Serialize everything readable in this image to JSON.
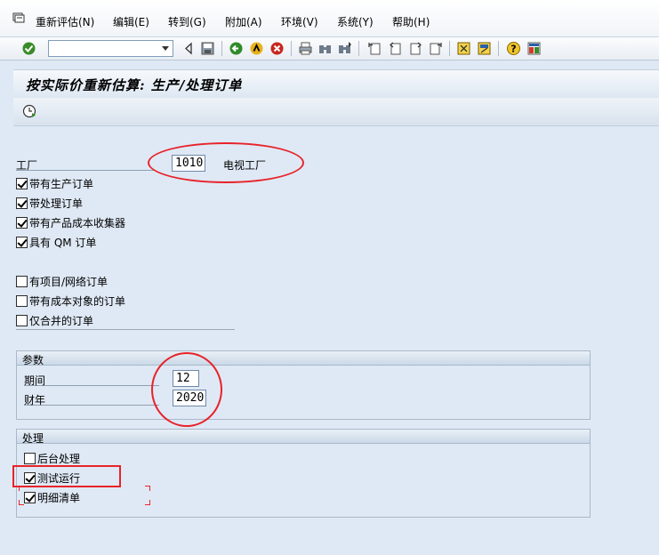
{
  "menu": {
    "items": [
      "重新评估(N)",
      "编辑(E)",
      "转到(G)",
      "附加(A)",
      "环境(V)",
      "系统(Y)",
      "帮助(H)"
    ]
  },
  "toolbar": {
    "command_value": "",
    "icons": [
      "enter-check-icon",
      "back-triangle-icon",
      "save-icon",
      "back-green-icon",
      "exit-yellow-icon",
      "cancel-red-icon",
      "print-icon",
      "find-icon",
      "find-next-icon",
      "first-page-icon",
      "prev-page-icon",
      "next-page-icon",
      "last-page-icon",
      "new-session-icon",
      "shortcut-icon",
      "help-icon",
      "customize-layout-icon"
    ]
  },
  "title": "按实际价重新估算: 生产/处理订单",
  "form": {
    "plant_label": "工厂",
    "plant_value": "1010",
    "plant_desc": "电视工厂",
    "checkboxes_top": [
      {
        "label": "带有生产订单",
        "checked": true
      },
      {
        "label": "带处理订单",
        "checked": true
      },
      {
        "label": "带有产品成本收集器",
        "checked": true
      },
      {
        "label": "具有 QM 订单",
        "checked": true
      }
    ],
    "checkboxes_bottom": [
      {
        "label": "有项目/网络订单",
        "checked": false
      },
      {
        "label": "带有成本对象的订单",
        "checked": false
      },
      {
        "label": "仅合并的订单",
        "checked": false
      }
    ]
  },
  "params": {
    "title": "参数",
    "period_label": "期间",
    "period_value": "12",
    "year_label": "财年",
    "year_value": "2020"
  },
  "processing": {
    "title": "处理",
    "options": [
      {
        "label": "后台处理",
        "checked": false
      },
      {
        "label": "测试运行",
        "checked": true
      },
      {
        "label": "明细清单",
        "checked": true
      }
    ]
  },
  "colors": {
    "highlight": "#e8232a",
    "background": "#dfe9f5"
  }
}
